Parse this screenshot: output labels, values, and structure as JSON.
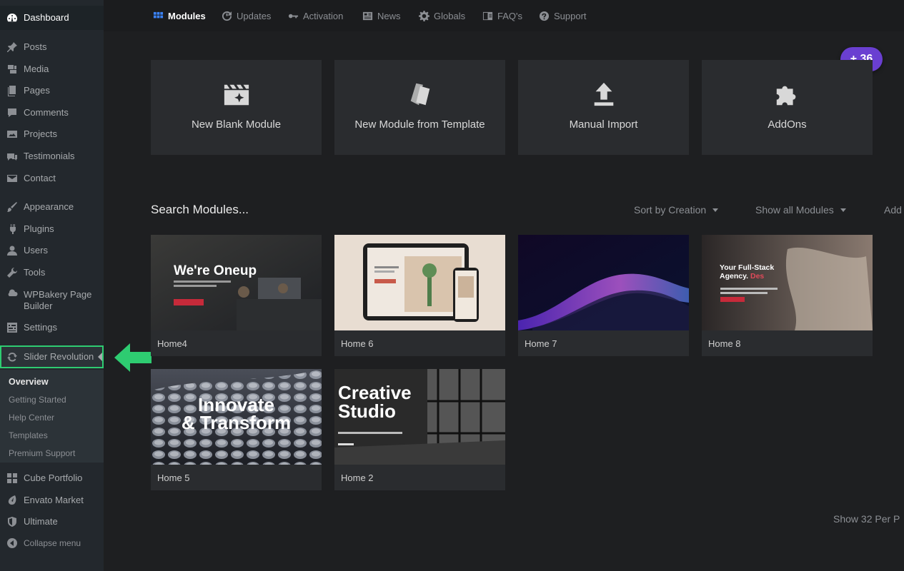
{
  "sidebar": {
    "dashboard": "Dashboard",
    "items": [
      {
        "label": "Posts",
        "icon": "pin-icon"
      },
      {
        "label": "Media",
        "icon": "media-icon"
      },
      {
        "label": "Pages",
        "icon": "pages-icon"
      },
      {
        "label": "Comments",
        "icon": "comments-icon"
      },
      {
        "label": "Projects",
        "icon": "projects-icon"
      },
      {
        "label": "Testimonials",
        "icon": "testimonials-icon"
      },
      {
        "label": "Contact",
        "icon": "mail-icon"
      },
      {
        "label": "Appearance",
        "icon": "brush-icon"
      },
      {
        "label": "Plugins",
        "icon": "plug-icon"
      },
      {
        "label": "Users",
        "icon": "users-icon"
      },
      {
        "label": "Tools",
        "icon": "wrench-icon"
      },
      {
        "label": "WPBakery Page Builder",
        "icon": "wpbakery-icon"
      },
      {
        "label": "Settings",
        "icon": "settings-icon"
      }
    ],
    "active": "Slider Revolution",
    "submenu": [
      "Overview",
      "Getting Started",
      "Help Center",
      "Templates",
      "Premium Support"
    ],
    "bottom_items": [
      {
        "label": "Cube Portfolio",
        "icon": "grid-icon"
      },
      {
        "label": "Envato Market",
        "icon": "envato-icon"
      },
      {
        "label": "Ultimate",
        "icon": "shield-icon"
      }
    ],
    "collapse": "Collapse menu"
  },
  "nav": [
    "Modules",
    "Updates",
    "Activation",
    "News",
    "Globals",
    "FAQ's",
    "Support"
  ],
  "pill": "+ 36",
  "actions": [
    "New Blank Module",
    "New Module from Template",
    "Manual Import",
    "AddOns"
  ],
  "search": {
    "title": "Search Modules...",
    "sort": "Sort by Creation",
    "filter": "Show all Modules",
    "add": "Add"
  },
  "modules": [
    {
      "name": "Home4",
      "headline": "We're Oneup"
    },
    {
      "name": "Home 6"
    },
    {
      "name": "Home 7"
    },
    {
      "name": "Home 8",
      "headline_a": "Your Full-Stack",
      "headline_b": "Agency.",
      "headline_c": "Des"
    },
    {
      "name": "Home 5",
      "headline_a": "Innovate",
      "headline_b": "& Transform"
    },
    {
      "name": "Home 2",
      "headline_a": "Creative",
      "headline_b": "Studio"
    }
  ],
  "per_page": "Show 32 Per P",
  "colors": {
    "accent": "#6a3fd1",
    "highlight": "#2ecc71",
    "nav_active": "#3b82f6"
  }
}
